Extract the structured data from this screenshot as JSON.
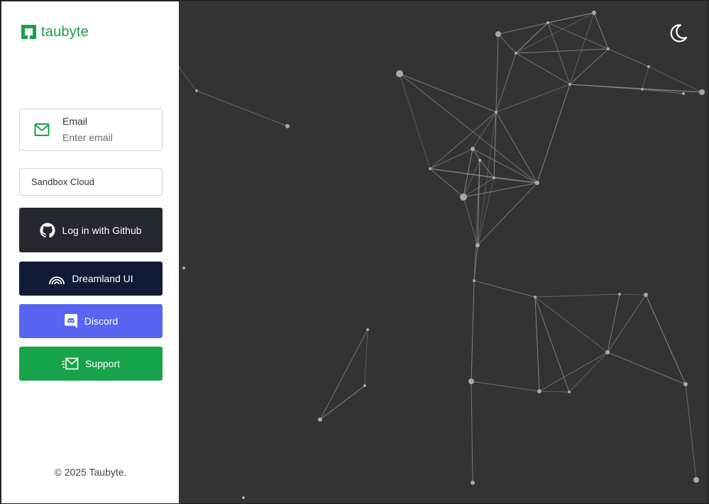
{
  "brand": {
    "name": "taubyte",
    "color": "#16a34a"
  },
  "login": {
    "email": {
      "label": "Email",
      "placeholder": "Enter email",
      "value": "",
      "icon": "mail-icon"
    },
    "network": {
      "selected": "Sandbox Cloud"
    },
    "buttons": [
      {
        "label": "Log in with Github",
        "icon": "github-icon",
        "color": "#24292f"
      },
      {
        "label": "Dreamland UI",
        "icon": "rainbow-icon",
        "color": "#111b35"
      },
      {
        "label": "Discord",
        "icon": "discord-icon",
        "color": "#5865f2"
      },
      {
        "label": "Support",
        "icon": "send-mail-icon",
        "color": "#16a34a"
      }
    ]
  },
  "footer": {
    "text": "© 2025 Taubyte."
  },
  "theme_toggle": {
    "icon": "moon-icon"
  },
  "background": {
    "color": "#333333"
  }
}
